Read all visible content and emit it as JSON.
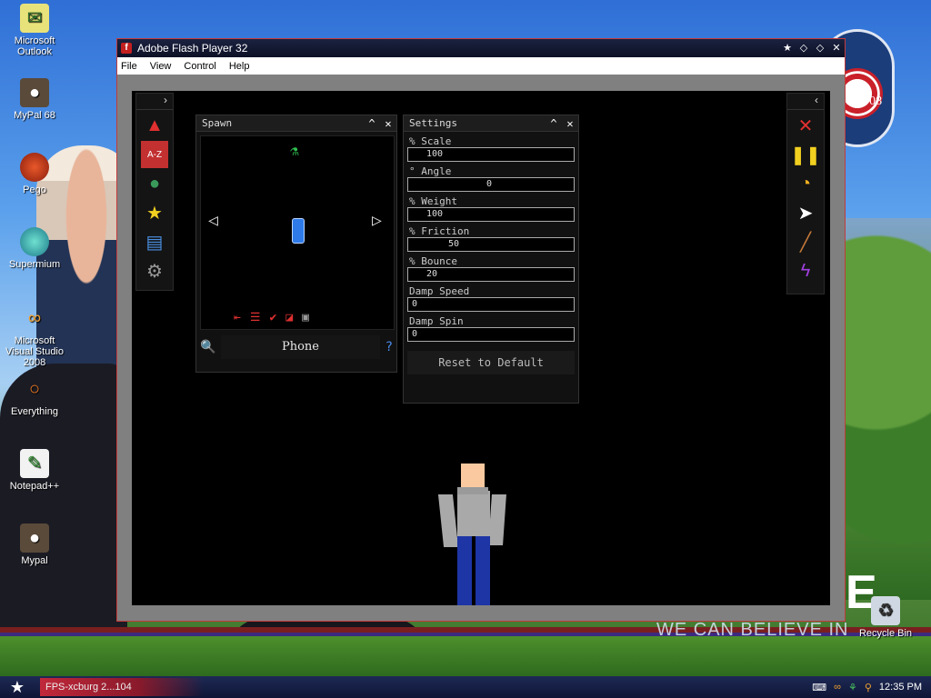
{
  "desktop": {
    "icons": [
      {
        "label": "Microsoft Outlook",
        "icon": "outlook-icon"
      },
      {
        "label": "MyPal 68",
        "icon": "mypal-raccoon-icon"
      },
      {
        "label": "Pego",
        "icon": "pego-icon"
      },
      {
        "label": "Supermium",
        "icon": "supermium-icon"
      },
      {
        "label": "Microsoft Visual Studio 2008",
        "icon": "visual-studio-icon"
      },
      {
        "label": "Everything",
        "icon": "everything-search-icon"
      },
      {
        "label": "Notepad++",
        "icon": "notepad-plus-plus-icon"
      },
      {
        "label": "Mypal",
        "icon": "mypal-raccoon-icon"
      },
      {
        "label": "Recycle Bin",
        "icon": "recycle-bin-icon"
      }
    ],
    "wallpaper_text": {
      "slogan": "WE CAN BELIEVE IN",
      "badge": "MA'08",
      "big_letter": "E"
    }
  },
  "window": {
    "title": "Adobe Flash Player 32",
    "menu": [
      "File",
      "View",
      "Control",
      "Help"
    ],
    "accent": "#c23c3c"
  },
  "game": {
    "spawn_panel": {
      "title": "Spawn",
      "selected_item": "Phone",
      "category_tabs": [
        "exit-red",
        "settings-red",
        "check-red",
        "shape-red",
        "robot-gray"
      ]
    },
    "settings_panel": {
      "title": "Settings",
      "fields": [
        {
          "label": "% Scale",
          "value": "100"
        },
        {
          "label": "° Angle",
          "value": "0"
        },
        {
          "label": "% Weight",
          "value": "100"
        },
        {
          "label": "% Friction",
          "value": "50"
        },
        {
          "label": "% Bounce",
          "value": "20"
        },
        {
          "label": "Damp Speed",
          "value": "0"
        },
        {
          "label": "Damp Spin",
          "value": "0"
        }
      ],
      "reset_label": "Reset to Default"
    },
    "left_toolbar": [
      "shapes-icon",
      "text-a-z-icon",
      "globe-icon",
      "star-icon",
      "save-disk-icon",
      "gear-icon"
    ],
    "right_toolbar": [
      "delete-x-icon",
      "pause-icon",
      "stopwatch-icon",
      "cursor-arrow-icon",
      "knife-icon",
      "lightning-icon"
    ]
  },
  "taskbar": {
    "task_label": "FPS-xcburg 2...104",
    "clock": "12:35 PM"
  }
}
